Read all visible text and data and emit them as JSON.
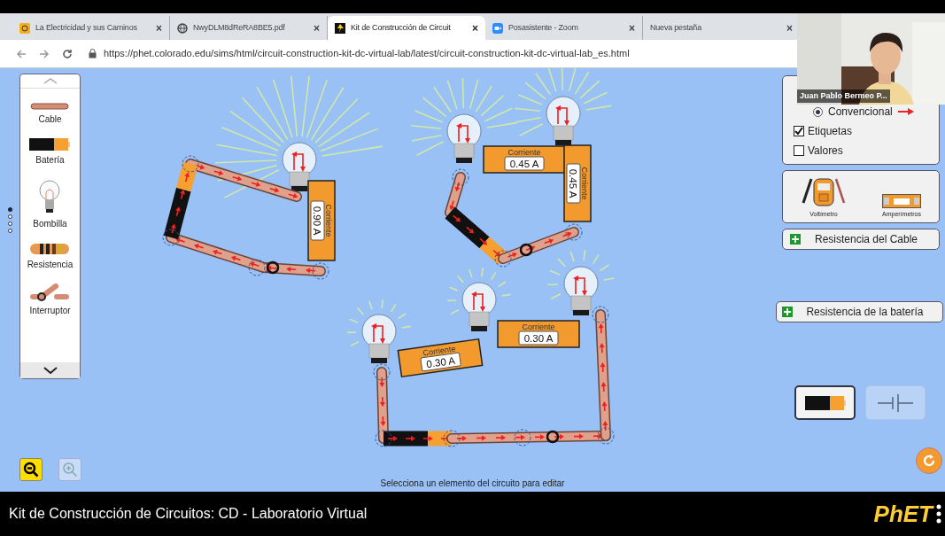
{
  "browser": {
    "tabs": [
      {
        "label": "La Electricidad y sus Caminos",
        "selected": false,
        "close": "×"
      },
      {
        "label": "NwyDLM8dReRA8BE5.pdf",
        "selected": false,
        "close": "×"
      },
      {
        "label": "Kit de Construcción de Circuit",
        "selected": true,
        "close": "×"
      },
      {
        "label": "Posasistente - Zoom",
        "selected": false,
        "close": "×"
      },
      {
        "label": "Nueva pestaña",
        "selected": false,
        "close": "×"
      }
    ],
    "url": "https://phet.colorado.edu/sims/html/circuit-construction-kit-dc-virtual-lab/latest/circuit-construction-kit-dc-virtual-lab_es.html"
  },
  "toolbox": {
    "items": [
      {
        "label": "Cable"
      },
      {
        "label": "Batería"
      },
      {
        "label": "Bombilla"
      },
      {
        "label": "Resistencia"
      },
      {
        "label": "Interruptor"
      }
    ],
    "pages": [
      {
        "selected": true
      },
      {
        "selected": false
      },
      {
        "selected": false
      },
      {
        "selected": false
      }
    ]
  },
  "circuits": [
    {
      "ammeters": [
        {
          "title": "Corriente",
          "reading": "0.90 A"
        }
      ]
    },
    {
      "ammeters": [
        {
          "title": "Corriente",
          "reading": "0.45 A"
        },
        {
          "title": "Corriente",
          "reading": "0.45 A"
        }
      ]
    },
    {
      "ammeters": [
        {
          "title": "Corriente",
          "reading": "0.30 A"
        },
        {
          "title": "Corriente",
          "reading": "0.30 A"
        }
      ]
    }
  ],
  "display_panel": {
    "current": {
      "label": "Convencional",
      "selected": true
    },
    "options": [
      {
        "label": "Etiquetas",
        "checked": true
      },
      {
        "label": "Valores",
        "checked": false
      }
    ]
  },
  "sensors": [
    {
      "label": "Voltímetro"
    },
    {
      "label": "Amperímetros"
    }
  ],
  "buttons": [
    {
      "label": "Resistencia del Cable"
    },
    {
      "label": "Resistencia de la batería"
    }
  ],
  "battery_types": [
    {
      "selected": true
    },
    {
      "selected": false
    }
  ],
  "zoom": {
    "zoom_out_enabled": true,
    "zoom_in_enabled": false
  },
  "status": "Selecciona un elemento del circuito para editar",
  "footer": {
    "title": "Kit de Construcción de Circuitos: CD - Laboratorio Virtual",
    "logo": "PhET"
  },
  "webcam": {
    "name": "Juan Pablo Bermeo P..."
  }
}
